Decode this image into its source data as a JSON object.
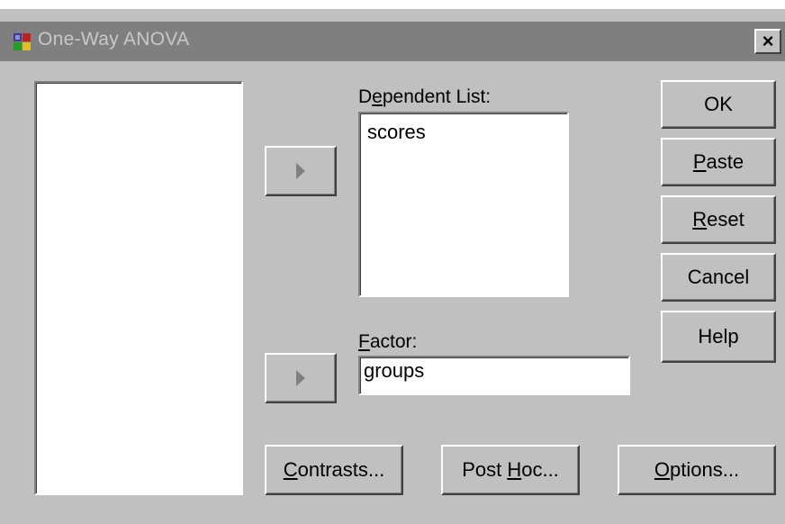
{
  "window": {
    "title": "One-Way ANOVA",
    "close_label": "×"
  },
  "dependent_list": {
    "label_before": "D",
    "label_mnemonic": "e",
    "label_after": "pendent List:",
    "items": [
      "scores"
    ]
  },
  "factor": {
    "label_mnemonic": "F",
    "label_after": "actor:",
    "value": "groups"
  },
  "buttons": {
    "ok": "OK",
    "paste": {
      "mnemonic": "P",
      "rest": "aste"
    },
    "reset": {
      "mnemonic": "R",
      "rest": "eset"
    },
    "cancel": "Cancel",
    "help": "Help",
    "contrasts": {
      "mnemonic": "C",
      "rest": "ontrasts..."
    },
    "post_hoc": {
      "before": "Post ",
      "mnemonic": "H",
      "rest": "oc..."
    },
    "options": {
      "mnemonic": "O",
      "rest": "ptions..."
    }
  },
  "icons": {
    "app": "spss-app-icon",
    "move_right": "right-arrow-icon"
  }
}
